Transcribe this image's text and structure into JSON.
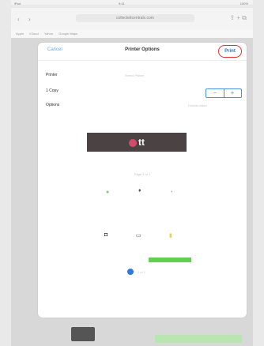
{
  "status": {
    "carrier": "iPad",
    "time": "9:41",
    "battery": "100%"
  },
  "browser": {
    "url": "collecteitcentrals.com",
    "back": "‹",
    "forward": "›",
    "bookmarks": [
      "Apple",
      "iCloud",
      "Yahoo",
      "Google Maps"
    ],
    "right_icons": "⇪  +  ⧉"
  },
  "sheet": {
    "cancel_label": "Cancel",
    "title": "Printer Options",
    "print_label": "Print",
    "rows": [
      {
        "label": "Printer",
        "value": "Select Printer"
      },
      {
        "label": "1 Copy",
        "value": ""
      },
      {
        "label": "Options",
        "value": "Double-sided"
      }
    ],
    "stepper": {
      "minus": "−",
      "plus": "+"
    },
    "toast_text": "tt",
    "preview_label": "Page 1 of 1",
    "page_label": "1 of 1"
  },
  "colors": {
    "accent": "#4a90e2",
    "print_circle": "#e3312f",
    "toast_bg": "#4b4343",
    "green": "#5fd04f"
  }
}
